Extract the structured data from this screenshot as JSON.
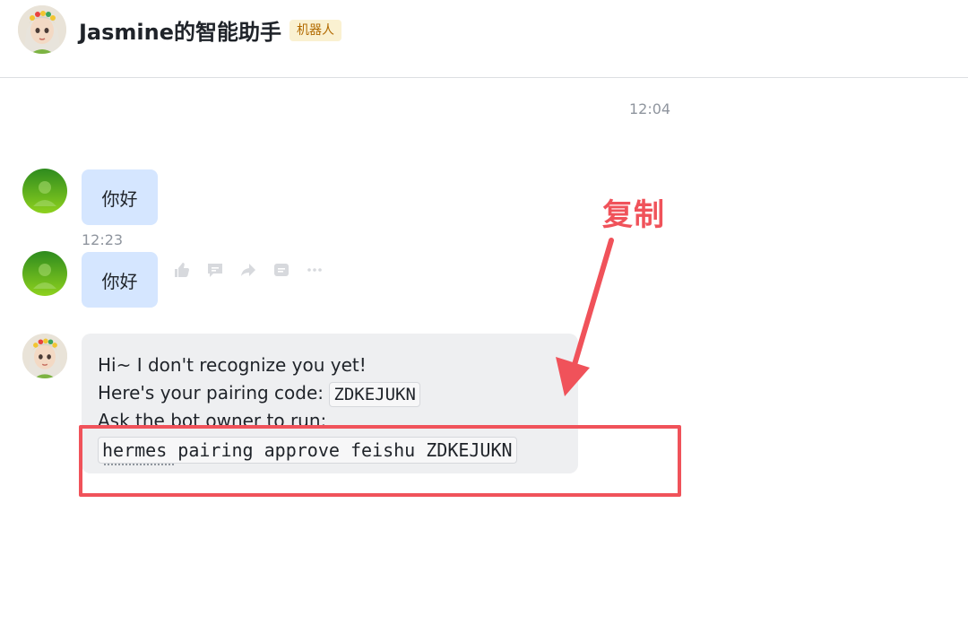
{
  "header": {
    "title": "Jasmine的智能助手",
    "badge": "机器人"
  },
  "messages": {
    "time_top": "12:04",
    "user_msg_1": "你好",
    "time_second": "12:23",
    "user_msg_2": "你好",
    "bot_reply": {
      "line1": "Hi~ I don't recognize you yet!",
      "line2_prefix": "Here's your pairing code:",
      "pairing_code": "ZDKEJUKN",
      "line3": "Ask the bot owner to run:",
      "command": "hermes pairing approve feishu ZDKEJUKN"
    }
  },
  "message_actions": [
    "thumbs-up-icon",
    "comment-icon",
    "forward-icon",
    "quote-icon",
    "more-icon"
  ],
  "annotation": {
    "label": "复制",
    "color": "#f0525a"
  },
  "colors": {
    "user_bubble": "#d5e6ff",
    "bot_bubble": "#eeeff1",
    "badge_bg": "#faf1d1",
    "badge_text": "#b26a00"
  }
}
